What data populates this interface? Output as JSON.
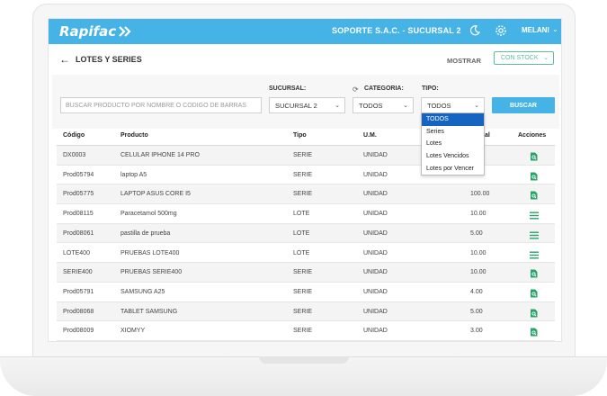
{
  "header": {
    "logo_text": "Rapifac",
    "company": "SOPORTE S.A.C. - SUCURSAL 2",
    "user": "MELANI"
  },
  "page": {
    "title": "LOTES Y SERIES",
    "mostrar_label": "MOSTRAR",
    "stock_value": "CON STOCK"
  },
  "filters": {
    "search_placeholder": "BUSCAR PRODUCTO POR NOMBRE O CODIGO DE BARRAS",
    "sucursal_label": "SUCURSAL:",
    "sucursal_value": "SUCURSAL 2",
    "categoria_label": "CATEGORIA:",
    "categoria_value": "TODOS",
    "tipo_label": "TIPO:",
    "tipo_value": "TODOS",
    "buscar_label": "BUSCAR",
    "tipo_options": [
      "TODOS",
      "Series",
      "Lotes",
      "Lotes Vencidos",
      "Lotes por Vencer"
    ]
  },
  "table": {
    "headers": {
      "codigo": "Código",
      "producto": "Producto",
      "tipo": "Tipo",
      "um": "U.M.",
      "stock": "al",
      "acciones": "Acciones"
    },
    "rows": [
      {
        "codigo": "DX0003",
        "producto": "CELULAR IPHONE 14 PRO",
        "tipo": "SERIE",
        "um": "UNIDAD",
        "stock": "",
        "action": "search-doc"
      },
      {
        "codigo": "Prod05794",
        "producto": "laptop A5",
        "tipo": "SERIE",
        "um": "UNIDAD",
        "stock": "",
        "action": "search-doc"
      },
      {
        "codigo": "Prod05775",
        "producto": "LAPTOP ASUS CORE I5",
        "tipo": "SERIE",
        "um": "UNIDAD",
        "stock": "100.00",
        "action": "search-doc"
      },
      {
        "codigo": "Prod08115",
        "producto": "Paracetamol 500mg",
        "tipo": "LOTE",
        "um": "UNIDAD",
        "stock": "10.00",
        "action": "menu"
      },
      {
        "codigo": "Prod08061",
        "producto": "pastilla de prueba",
        "tipo": "LOTE",
        "um": "UNIDAD",
        "stock": "5.00",
        "action": "menu"
      },
      {
        "codigo": "LOTE400",
        "producto": "PRUEBAS LOTE400",
        "tipo": "LOTE",
        "um": "UNIDAD",
        "stock": "10.00",
        "action": "menu"
      },
      {
        "codigo": "SERIE400",
        "producto": "PRUEBAS SERIE400",
        "tipo": "SERIE",
        "um": "UNIDAD",
        "stock": "10.00",
        "action": "search-doc"
      },
      {
        "codigo": "Prod05791",
        "producto": "SAMSUNG A25",
        "tipo": "SERIE",
        "um": "UNIDAD",
        "stock": "4.00",
        "action": "search-doc"
      },
      {
        "codigo": "Prod08068",
        "producto": "TABLET SAMSUNG",
        "tipo": "SERIE",
        "um": "UNIDAD",
        "stock": "5.00",
        "action": "search-doc"
      },
      {
        "codigo": "Prod08009",
        "producto": "XIOMYY",
        "tipo": "SERIE",
        "um": "UNIDAD",
        "stock": "3.00",
        "action": "search-doc"
      }
    ]
  },
  "colors": {
    "primary": "#46b3e6",
    "accent": "#5bc09a",
    "selected": "#1565c0"
  }
}
